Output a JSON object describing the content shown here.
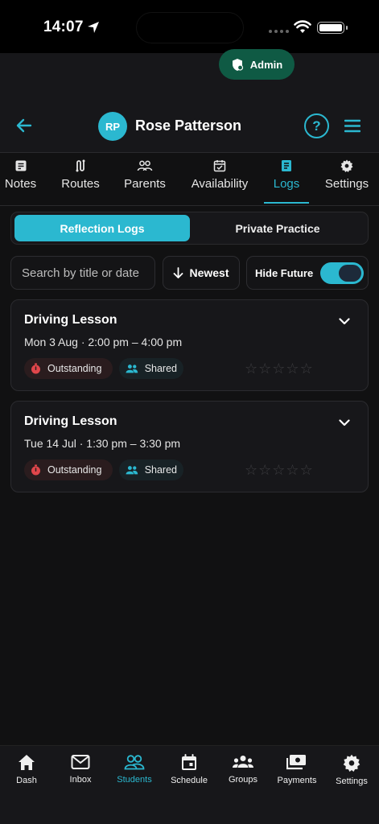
{
  "status_bar": {
    "time": "14:07"
  },
  "role_pill": {
    "label": "Admin",
    "icon": "shield-icon"
  },
  "header": {
    "avatar_initials": "RP",
    "student_name": "Rose Patterson",
    "help_label": "?"
  },
  "tabs": [
    {
      "label": "Notes",
      "icon": "notes-icon"
    },
    {
      "label": "Routes",
      "icon": "route-icon"
    },
    {
      "label": "Parents",
      "icon": "parents-icon"
    },
    {
      "label": "Availability",
      "icon": "calendar-check-icon"
    },
    {
      "label": "Logs",
      "icon": "document-icon",
      "active": true
    },
    {
      "label": "Settings",
      "icon": "gear-icon"
    }
  ],
  "segments": {
    "selected": "Reflection Logs",
    "other": "Private Practice"
  },
  "filters": {
    "search_placeholder": "Search by title or date",
    "sort_label": "Newest",
    "hide_future_label": "Hide Future",
    "hide_future_on": true
  },
  "logs": [
    {
      "title": "Driving Lesson",
      "when": "Mon 3 Aug · 2:00 pm – 4:00 pm",
      "status": "Outstanding",
      "sharing": "Shared",
      "rating": 0,
      "max_rating": 5
    },
    {
      "title": "Driving Lesson",
      "when": "Tue 14 Jul · 1:30 pm – 3:30 pm",
      "status": "Outstanding",
      "sharing": "Shared",
      "rating": 0,
      "max_rating": 5
    }
  ],
  "bottom_nav": [
    {
      "label": "Dash",
      "icon": "home-icon"
    },
    {
      "label": "Inbox",
      "icon": "mail-icon"
    },
    {
      "label": "Students",
      "icon": "students-icon",
      "active": true
    },
    {
      "label": "Schedule",
      "icon": "calendar-icon"
    },
    {
      "label": "Groups",
      "icon": "groups-icon"
    },
    {
      "label": "Payments",
      "icon": "payments-icon"
    },
    {
      "label": "Settings",
      "icon": "gear-icon"
    }
  ],
  "colors": {
    "accent": "#2bb8d0",
    "admin_pill": "#0f5a44",
    "outstanding": "#e0464b",
    "background": "#111112"
  }
}
